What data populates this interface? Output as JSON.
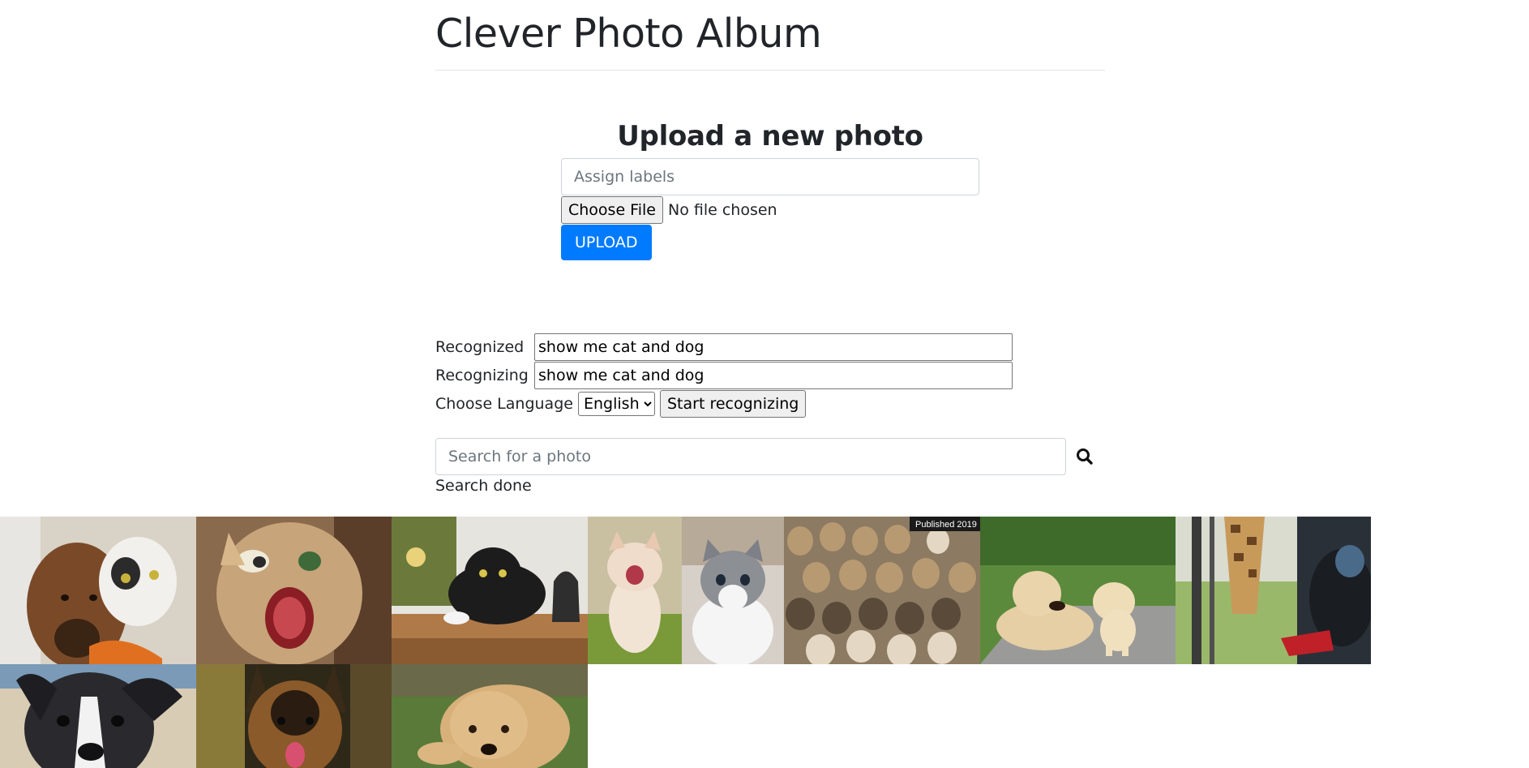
{
  "header": {
    "title": "Clever Photo Album"
  },
  "upload": {
    "heading": "Upload a new photo",
    "labels_placeholder": "Assign labels",
    "choose_file_label": "Choose File",
    "file_status": "No file chosen",
    "upload_button": "UPLOAD"
  },
  "speech": {
    "recognized_label": "Recognized  :",
    "recognized_value": "show me cat and dog",
    "recognizing_label": "Recognizing :",
    "recognizing_value": "show me cat and dog",
    "language_label": "Choose Language :",
    "language_selected": "English",
    "start_button": "Start recognizing"
  },
  "search": {
    "placeholder": "Search for a photo",
    "icon": "search-icon",
    "status": "Search done"
  },
  "photos": [
    {
      "name": "dog-and-cat-photo",
      "published_badge": ""
    },
    {
      "name": "hissing-cat-photo",
      "published_badge": ""
    },
    {
      "name": "black-white-cat-photo",
      "published_badge": ""
    },
    {
      "name": "yawning-kitten-photo",
      "published_badge": ""
    },
    {
      "name": "grey-kitten-photo",
      "published_badge": ""
    },
    {
      "name": "many-cats-photo",
      "published_badge": "Published 2019"
    },
    {
      "name": "dog-and-puppy-photo",
      "published_badge": ""
    },
    {
      "name": "giraffe-bus-photo",
      "published_badge": ""
    },
    {
      "name": "black-puppy-photo",
      "published_badge": ""
    },
    {
      "name": "german-shepherd-photo",
      "published_badge": ""
    },
    {
      "name": "golden-puppy-photo",
      "published_badge": ""
    }
  ],
  "colors": {
    "primary": "#007bff",
    "text": "#212529",
    "placeholder": "#6c757d"
  }
}
